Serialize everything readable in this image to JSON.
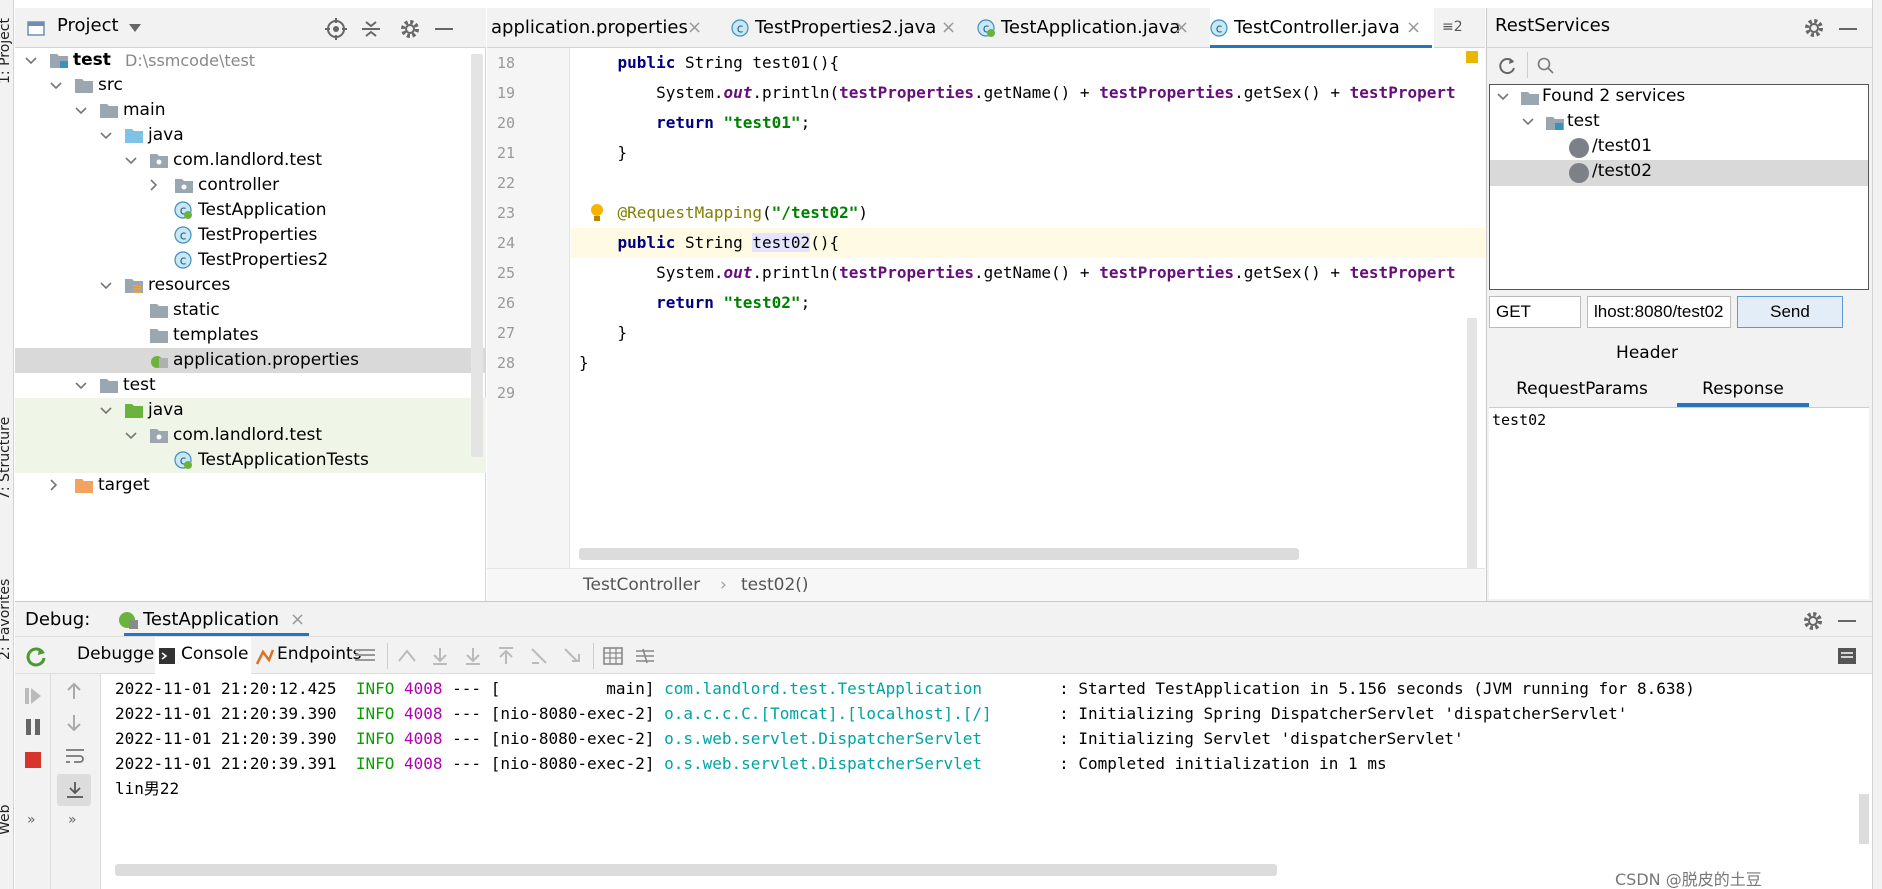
{
  "project_panel": {
    "title": "Project",
    "tree": [
      {
        "label": "test",
        "extra": "D:\\ssmcode\\test",
        "level": 0,
        "arrow": "down",
        "icon": "module-folder"
      },
      {
        "label": "src",
        "level": 1,
        "arrow": "down",
        "icon": "folder"
      },
      {
        "label": "main",
        "level": 2,
        "arrow": "down",
        "icon": "folder"
      },
      {
        "label": "java",
        "level": 3,
        "arrow": "down",
        "icon": "source-folder"
      },
      {
        "label": "com.landlord.test",
        "level": 4,
        "arrow": "down",
        "icon": "package"
      },
      {
        "label": "controller",
        "level": 5,
        "arrow": "right",
        "icon": "package"
      },
      {
        "label": "TestApplication",
        "level": 5,
        "arrow": "none",
        "icon": "spring-class"
      },
      {
        "label": "TestProperties",
        "level": 5,
        "arrow": "none",
        "icon": "class"
      },
      {
        "label": "TestProperties2",
        "level": 5,
        "arrow": "none",
        "icon": "class"
      },
      {
        "label": "resources",
        "level": 3,
        "arrow": "down",
        "icon": "resources-folder"
      },
      {
        "label": "static",
        "level": 4,
        "arrow": "none",
        "icon": "folder"
      },
      {
        "label": "templates",
        "level": 4,
        "arrow": "none",
        "icon": "folder"
      },
      {
        "label": "application.properties",
        "level": 4,
        "arrow": "none",
        "icon": "properties-file",
        "selected": true
      },
      {
        "label": "test",
        "level": 2,
        "arrow": "down",
        "icon": "folder"
      },
      {
        "label": "java",
        "level": 3,
        "arrow": "down",
        "icon": "test-folder",
        "green": true
      },
      {
        "label": "com.landlord.test",
        "level": 4,
        "arrow": "down",
        "icon": "package",
        "green": true
      },
      {
        "label": "TestApplicationTests",
        "level": 5,
        "arrow": "none",
        "icon": "spring-class",
        "green": true
      },
      {
        "label": "target",
        "level": 1,
        "arrow": "right",
        "icon": "excluded-folder"
      }
    ]
  },
  "editor": {
    "tabs": [
      {
        "label": "application.properties",
        "icon": "properties-file",
        "active": false
      },
      {
        "label": "TestProperties2.java",
        "icon": "class",
        "active": false
      },
      {
        "label": "TestApplication.java",
        "icon": "spring-class",
        "active": false
      },
      {
        "label": "TestController.java",
        "icon": "class",
        "active": true
      }
    ],
    "tab_overflow": "≡2",
    "line_numbers": [
      "18",
      "19",
      "20",
      "21",
      "22",
      "23",
      "24",
      "25",
      "26",
      "27",
      "28",
      "29"
    ],
    "breadcrumb": [
      "TestController",
      "test02()"
    ]
  },
  "rest_services": {
    "title": "RestServices",
    "found": "Found 2 services",
    "module": "test",
    "endpoints": [
      "/test01",
      "/test02"
    ],
    "selected_endpoint": "/test02",
    "method": "GET",
    "url": "lhost:8080/test02",
    "send_label": "Send",
    "header_label": "Header",
    "tabs": [
      "RequestParams",
      "Response"
    ],
    "active_tab": "Response",
    "response": "test02"
  },
  "debug": {
    "label": "Debug:",
    "run_config": "TestApplication",
    "tabs": [
      "Debugger",
      "Console",
      "Endpoints"
    ],
    "active_tab": "Console",
    "log": [
      {
        "ts": "2022-11-01 21:20:12.425",
        "level": "INFO",
        "pid": "4008",
        "sep": "---",
        "thread": "[           main]",
        "logger": "com.landlord.test.TestApplication       ",
        "msg": ": Started TestApplication in 5.156 seconds (JVM running for 8.638)"
      },
      {
        "ts": "2022-11-01 21:20:39.390",
        "level": "INFO",
        "pid": "4008",
        "sep": "---",
        "thread": "[nio-8080-exec-2]",
        "logger": "o.a.c.c.C.[Tomcat].[localhost].[/]      ",
        "msg": ": Initializing Spring DispatcherServlet 'dispatcherServlet'"
      },
      {
        "ts": "2022-11-01 21:20:39.390",
        "level": "INFO",
        "pid": "4008",
        "sep": "---",
        "thread": "[nio-8080-exec-2]",
        "logger": "o.s.web.servlet.DispatcherServlet       ",
        "msg": ": Initializing Servlet 'dispatcherServlet'"
      },
      {
        "ts": "2022-11-01 21:20:39.391",
        "level": "INFO",
        "pid": "4008",
        "sep": "---",
        "thread": "[nio-8080-exec-2]",
        "logger": "o.s.web.servlet.DispatcherServlet       ",
        "msg": ": Completed initialization in 1 ms"
      }
    ],
    "stdout": "lin男22"
  },
  "side_labels": {
    "project": "1: Project",
    "structure": "7: Structure",
    "favorites": "2: Favorites",
    "web": "Web"
  },
  "watermark": "CSDN @脱皮的土豆",
  "colors": {
    "accent": "#2675bf",
    "selection": "#d9d9d9",
    "test_green": "#eff6e8",
    "string": "#008000",
    "keyword": "#000080"
  }
}
